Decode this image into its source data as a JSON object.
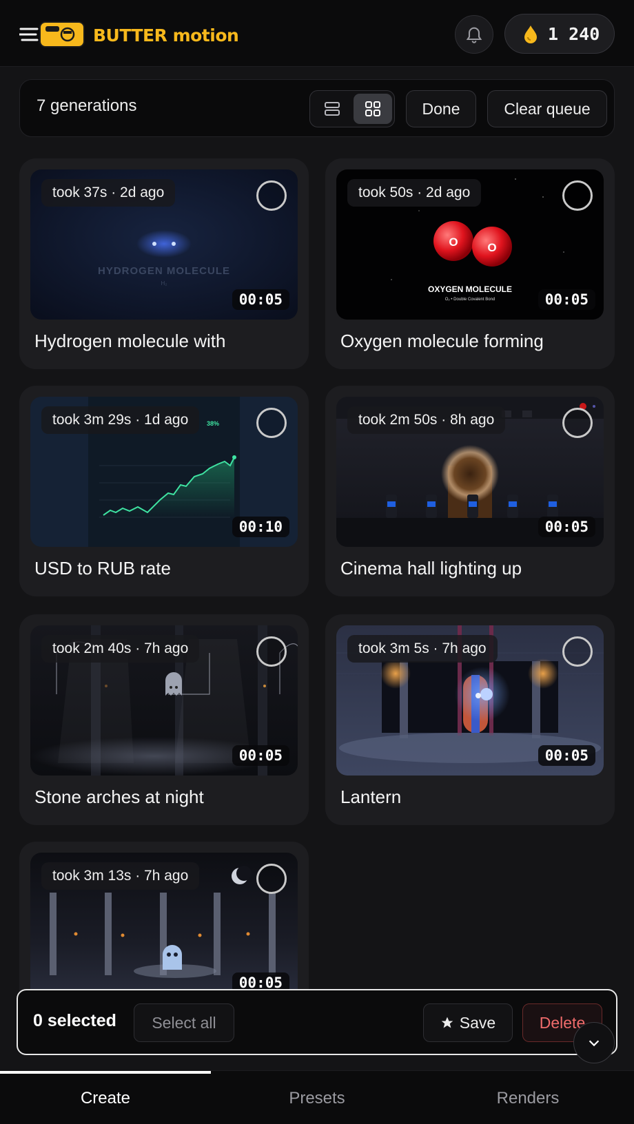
{
  "brand": {
    "name": "BUTTER motion",
    "color": "#f7b81c"
  },
  "header": {
    "credits": "1 240"
  },
  "toolbar": {
    "count_label": "7 generations",
    "done_label": "Done",
    "clear_label": "Clear queue"
  },
  "cards": [
    {
      "meta": "took 37s · 2d ago",
      "duration": "00:05",
      "title": "Hydrogen molecule with",
      "overlay": "HYDROGEN MOLECULE",
      "overlay_sub": "H₂"
    },
    {
      "meta": "took 50s · 2d ago",
      "duration": "00:05",
      "title": "Oxygen molecule forming",
      "overlay": "OXYGEN MOLECULE",
      "overlay_sub": "O₂ • Double Covalent Bond",
      "atom_label": "O"
    },
    {
      "meta": "took 3m 29s · 1d ago",
      "duration": "00:10",
      "title": "USD to RUB rate",
      "overlay": "38%"
    },
    {
      "meta": "took 2m 50s · 8h ago",
      "duration": "00:05",
      "title": "Cinema hall lighting up"
    },
    {
      "meta": "took 2m 40s · 7h ago",
      "duration": "00:05",
      "title": "Stone arches at night"
    },
    {
      "meta": "took 3m 5s · 7h ago",
      "duration": "00:05",
      "title": "Lantern"
    },
    {
      "meta": "took 3m 13s · 7h ago",
      "duration": "00:05",
      "title": ""
    }
  ],
  "selection": {
    "count_label": "0 selected",
    "select_all": "Select all",
    "save": "Save",
    "delete": "Delete"
  },
  "nav": {
    "tabs": [
      "Create",
      "Presets",
      "Renders"
    ],
    "active": "Create"
  },
  "icons": [
    "logo-icon",
    "bell-icon",
    "drop-icon",
    "list-view-icon",
    "grid-view-icon",
    "star-icon",
    "chevron-down-icon"
  ]
}
